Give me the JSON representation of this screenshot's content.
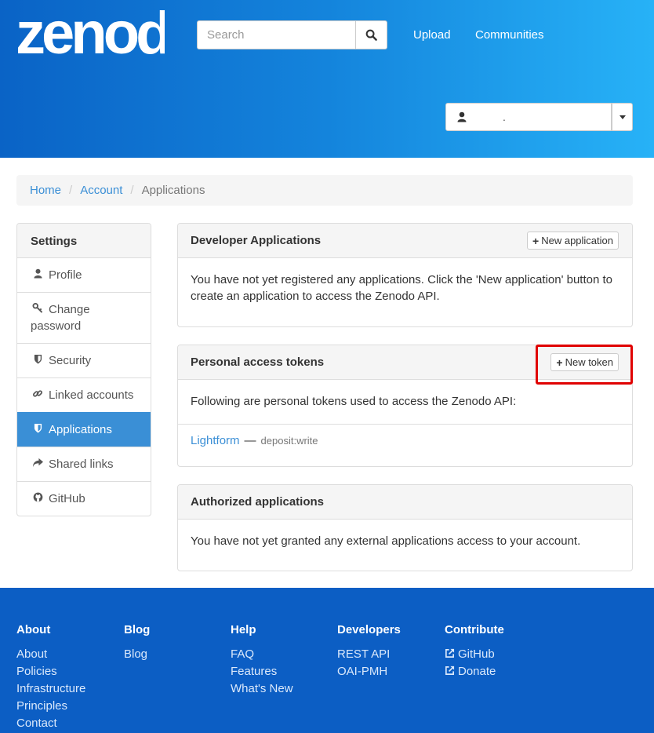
{
  "header": {
    "logo_text": "zenodo",
    "search_placeholder": "Search",
    "nav": [
      "Upload",
      "Communities"
    ],
    "user_name": "."
  },
  "breadcrumb": [
    "Home",
    "Account",
    "Applications"
  ],
  "sidebar": {
    "title": "Settings",
    "items": [
      {
        "label": "Profile",
        "icon": "user-icon"
      },
      {
        "label": "Change password",
        "icon": "key-icon"
      },
      {
        "label": "Security",
        "icon": "shield-icon"
      },
      {
        "label": "Linked accounts",
        "icon": "link-icon"
      },
      {
        "label": "Applications",
        "icon": "shield-icon",
        "active": true
      },
      {
        "label": "Shared links",
        "icon": "share-icon"
      },
      {
        "label": "GitHub",
        "icon": "github-icon"
      }
    ]
  },
  "dev_apps": {
    "title": "Developer Applications",
    "button": "New application",
    "text": "You have not yet registered any applications. Click the 'New application' button to create an application to access the Zenodo API."
  },
  "tokens": {
    "title": "Personal access tokens",
    "button": "New token",
    "text": "Following are personal tokens used to access the Zenodo API:",
    "items": [
      {
        "name": "Lightform",
        "dash": "—",
        "scope": "deposit:write"
      }
    ]
  },
  "authorized": {
    "title": "Authorized applications",
    "text": "You have not yet granted any external applications access to your account."
  },
  "footer": {
    "columns": [
      {
        "title": "About",
        "links": [
          "About",
          "Policies",
          "Infrastructure",
          "Principles",
          "Contact"
        ]
      },
      {
        "title": "Blog",
        "links": [
          "Blog"
        ]
      },
      {
        "title": "Help",
        "links": [
          "FAQ",
          "Features",
          "What's New"
        ]
      },
      {
        "title": "Developers",
        "links": [
          "REST API",
          "OAI-PMH"
        ]
      },
      {
        "title": "Contribute",
        "links": [
          "GitHub",
          "Donate"
        ]
      }
    ]
  },
  "colors": {
    "primary": "#3a8fd6",
    "footer": "#0c5ec4",
    "highlight": "#e00000"
  }
}
